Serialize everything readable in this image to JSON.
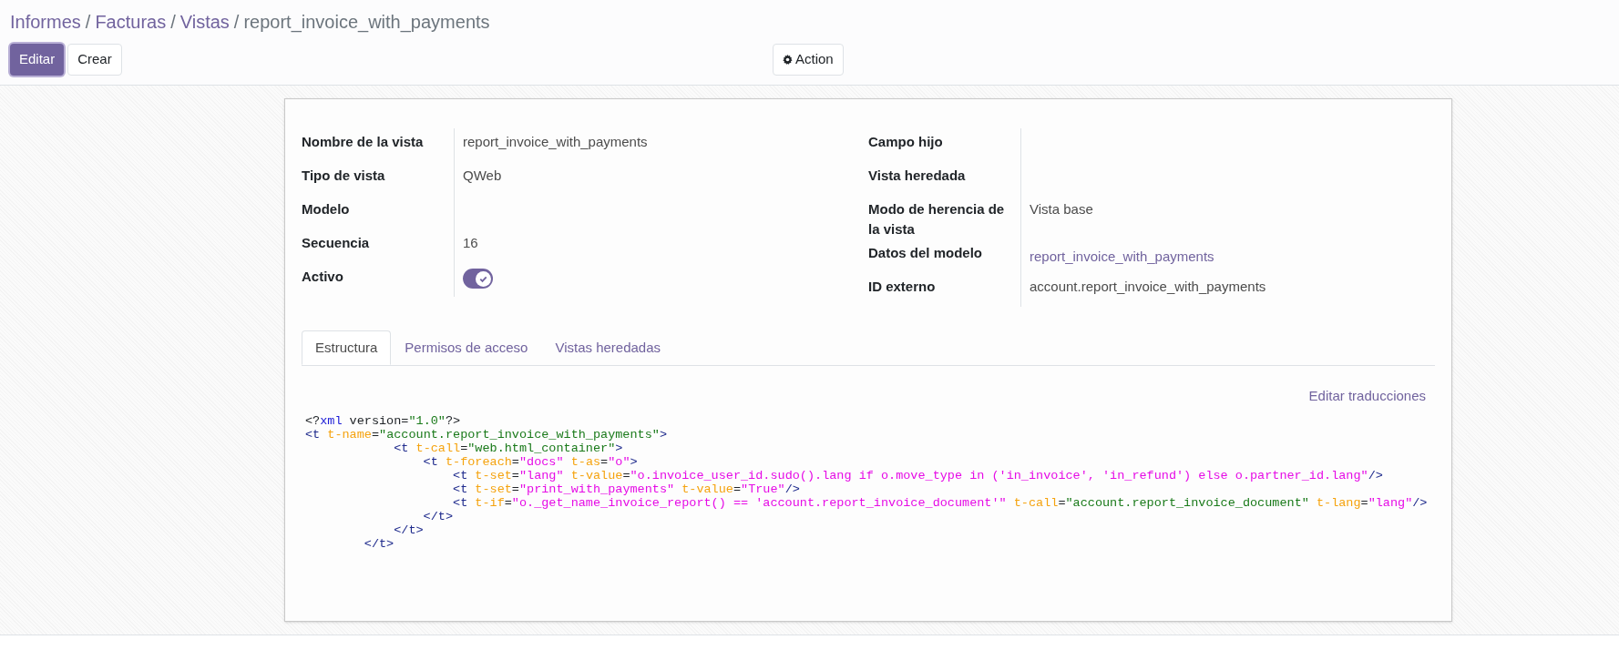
{
  "breadcrumb": [
    {
      "label": "Informes",
      "link": true
    },
    {
      "separator": "/",
      "label": "Facturas",
      "link": true
    },
    {
      "separator": "/",
      "label": "Vistas",
      "link": true
    },
    {
      "separator": "/",
      "label": "report_invoice_with_payments",
      "link": false
    }
  ],
  "buttons": [
    {
      "label": "Editar",
      "kind": "primary"
    },
    {
      "label": "Crear",
      "kind": "secondary"
    }
  ],
  "action_button": {
    "label": "Action"
  },
  "fields_left": [
    {
      "label": "Nombre de la vista",
      "value": "report_invoice_with_payments",
      "kind": "text"
    },
    {
      "label": "Tipo de vista",
      "value": "QWeb",
      "kind": "text"
    },
    {
      "label": "Modelo",
      "kind": "text"
    },
    {
      "label": "Secuencia",
      "value": "16",
      "kind": "text"
    },
    {
      "label": "Activo",
      "kind": "toggle",
      "on": true
    }
  ],
  "fields_right": [
    {
      "label": "Campo hijo",
      "kind": "text"
    },
    {
      "label": "Vista heredada",
      "kind": "text"
    },
    {
      "label": "Modo de herencia de la vista",
      "value": "Vista base",
      "kind": "text"
    },
    {
      "label": "Datos del modelo",
      "value": "report_invoice_with_payments",
      "kind": "link"
    },
    {
      "label": "ID externo",
      "value": "account.report_invoice_with_payments",
      "kind": "text"
    }
  ],
  "tabs": [
    {
      "label": "Estructura",
      "selected": true
    },
    {
      "label": "Permisos de acceso",
      "selected": false
    },
    {
      "label": "Vistas heredadas",
      "selected": false
    }
  ],
  "translate_link": "Editar traducciones",
  "code": [
    [
      {
        "kind": "plain",
        "text": "<?"
      },
      {
        "kind": "keyword",
        "text": "xml"
      },
      {
        "kind": "plain",
        "text": " version="
      },
      {
        "kind": "string",
        "text": "\"1.0\""
      },
      {
        "kind": "plain",
        "text": "?>"
      }
    ],
    [
      {
        "kind": "tag",
        "text": "<t "
      },
      {
        "kind": "attr",
        "text": "t-name"
      },
      {
        "kind": "plain",
        "text": "="
      },
      {
        "kind": "string",
        "text": "\"account.report_invoice_with_payments\""
      },
      {
        "kind": "tag",
        "text": ">"
      }
    ],
    [
      {
        "kind": "tag",
        "text": "            <t "
      },
      {
        "kind": "attr",
        "text": "t-call"
      },
      {
        "kind": "plain",
        "text": "="
      },
      {
        "kind": "string",
        "text": "\"web.html_container\""
      },
      {
        "kind": "tag",
        "text": ">"
      }
    ],
    [
      {
        "kind": "tag",
        "text": "                <t "
      },
      {
        "kind": "attr",
        "text": "t-foreach"
      },
      {
        "kind": "plain",
        "text": "="
      },
      {
        "kind": "expr",
        "text": "\"docs\""
      },
      {
        "kind": "attr",
        "text": " t-as"
      },
      {
        "kind": "plain",
        "text": "="
      },
      {
        "kind": "expr",
        "text": "\"o\""
      },
      {
        "kind": "tag",
        "text": ">"
      }
    ],
    [
      {
        "kind": "tag",
        "text": "                    <t "
      },
      {
        "kind": "attr",
        "text": "t-set"
      },
      {
        "kind": "plain",
        "text": "="
      },
      {
        "kind": "expr",
        "text": "\"lang\""
      },
      {
        "kind": "attr",
        "text": " t-value"
      },
      {
        "kind": "plain",
        "text": "="
      },
      {
        "kind": "expr",
        "text": "\"o.invoice_user_id.sudo().lang if o.move_type in ('in_invoice', 'in_refund') else o.partner_id.lang\""
      },
      {
        "kind": "tag",
        "text": "/>"
      }
    ],
    [
      {
        "kind": "tag",
        "text": "                    <t "
      },
      {
        "kind": "attr",
        "text": "t-set"
      },
      {
        "kind": "plain",
        "text": "="
      },
      {
        "kind": "expr",
        "text": "\"print_with_payments\""
      },
      {
        "kind": "attr",
        "text": " t-value"
      },
      {
        "kind": "plain",
        "text": "="
      },
      {
        "kind": "expr",
        "text": "\"True\""
      },
      {
        "kind": "tag",
        "text": "/>"
      }
    ],
    [
      {
        "kind": "tag",
        "text": "                    <t "
      },
      {
        "kind": "attr",
        "text": "t-if"
      },
      {
        "kind": "plain",
        "text": "="
      },
      {
        "kind": "expr",
        "text": "\"o._get_name_invoice_report() == 'account.report_invoice_document'\""
      },
      {
        "kind": "attr",
        "text": " t-call"
      },
      {
        "kind": "plain",
        "text": "="
      },
      {
        "kind": "string",
        "text": "\"account.report_invoice_document\""
      },
      {
        "kind": "attr",
        "text": " t-lang"
      },
      {
        "kind": "plain",
        "text": "="
      },
      {
        "kind": "expr",
        "text": "\"lang\""
      },
      {
        "kind": "tag",
        "text": "/>"
      }
    ],
    [
      {
        "kind": "tag",
        "text": "                </t>"
      }
    ],
    [
      {
        "kind": "tag",
        "text": "            </t>"
      }
    ],
    [
      {
        "kind": "tag",
        "text": "        </t>"
      }
    ]
  ]
}
